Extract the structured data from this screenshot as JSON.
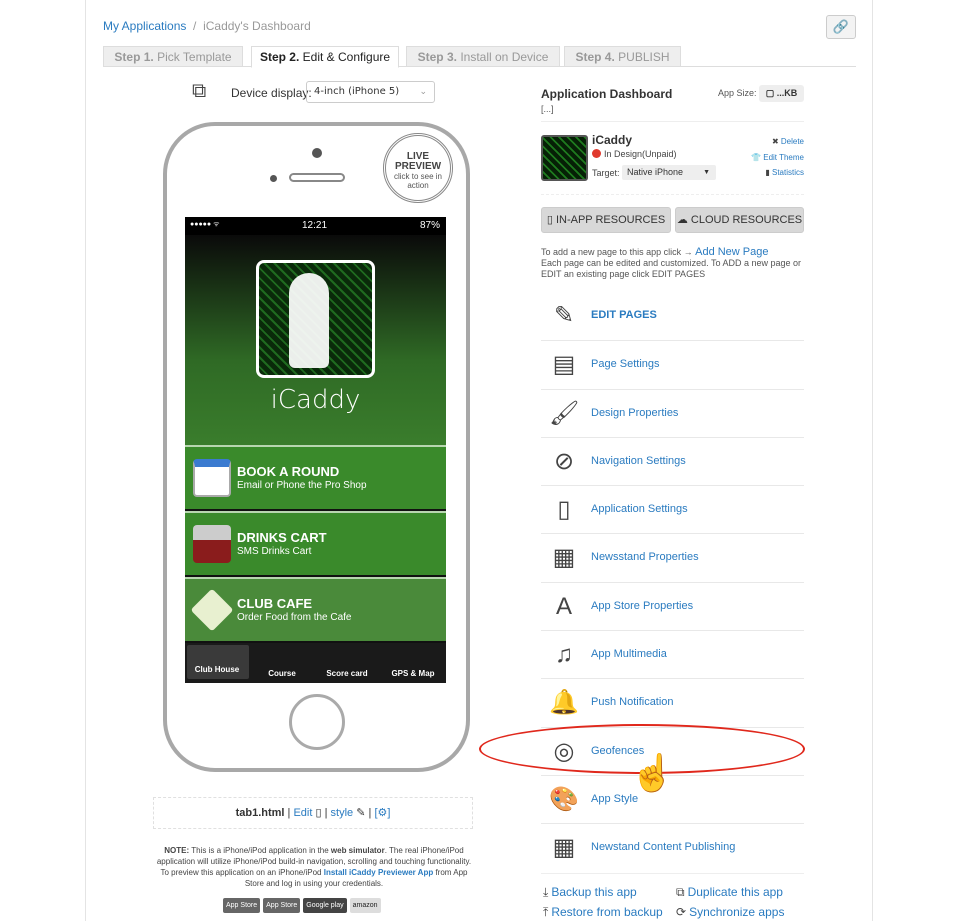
{
  "breadcrumb": {
    "home": "My Applications",
    "sep": "/",
    "current": "iCaddy's Dashboard"
  },
  "link_icon": "link-icon",
  "steps": [
    {
      "num": "Step 1.",
      "label": "Pick Template"
    },
    {
      "num": "Step 2.",
      "label": "Edit & Configure"
    },
    {
      "num": "Step 3.",
      "label": "Install on Device"
    },
    {
      "num": "Step 4.",
      "label": "PUBLISH"
    }
  ],
  "device": {
    "label": "Device display:",
    "value": "4-inch (iPhone 5)"
  },
  "phone": {
    "live_title": "LIVE PREVIEW",
    "live_sub": "click to see in action",
    "status_signal": "●●●●● ᯤ",
    "time": "12:21",
    "battery": "87%",
    "app_title": "iCaddy",
    "rows": [
      {
        "title": "BOOK A ROUND",
        "sub": "Email or Phone the Pro Shop",
        "icon": "calendar-icon"
      },
      {
        "title": "DRINKS CART",
        "sub": "SMS Drinks Cart",
        "icon": "golf-cart-icon"
      },
      {
        "title": "CLUB CAFE",
        "sub": "Order Food from the Cafe",
        "icon": "cutlery-icon"
      }
    ],
    "tabs": [
      "Club House",
      "Course",
      "Score card",
      "GPS & Map"
    ]
  },
  "filebar": {
    "file": "tab1.html",
    "edit": "Edit",
    "style": "style",
    "sep": "|",
    "settings": "[⚙]"
  },
  "note": {
    "lead": "NOTE:",
    "t1": " This is a iPhone/iPod application in the ",
    "b1": "web simulator",
    "t2": ". The real iPhone/iPod application will utilize iPhone/iPod build-in navigation, scrolling and touching functionality. To preview this application on an iPhone/iPod ",
    "link": "Install iCaddy Previewer App",
    "t3": " from App Store and log in using your credentials."
  },
  "stores": [
    "App Store",
    "App Store",
    "Google play",
    "amazon"
  ],
  "dashboard": {
    "title": "Application Dashboard",
    "dots": "[...]",
    "size_label": "App Size:",
    "size_value": "...KB",
    "app_name": "iCaddy",
    "status": "In Design(Unpaid)",
    "status_color": "#e03a2e",
    "target_label": "Target:",
    "target_value": "Native iPhone",
    "delete": "Delete",
    "edit_theme": "Edit Theme",
    "statistics": "Statistics",
    "inapp": "IN-APP RESOURCES",
    "cloud": "CLOUD RESOURCES",
    "help1": "To add a new page to this app click →",
    "help_link": "Add New Page",
    "help2": "Each page can be edited and customized. To ADD a new page or EDIT an existing page click EDIT PAGES"
  },
  "menu": [
    {
      "label": "EDIT PAGES",
      "icon": "pencil-icon",
      "glyph": "✎"
    },
    {
      "label": "Page Settings",
      "icon": "page-settings-icon",
      "glyph": "▤"
    },
    {
      "label": "Design Properties",
      "icon": "brush-css-icon",
      "glyph": "🖌"
    },
    {
      "label": "Navigation Settings",
      "icon": "compass-icon",
      "glyph": "⊘"
    },
    {
      "label": "Application Settings",
      "icon": "phone-settings-icon",
      "glyph": "▯"
    },
    {
      "label": "Newsstand Properties",
      "icon": "newsstand-icon",
      "glyph": "▦"
    },
    {
      "label": "App Store Properties",
      "icon": "app-store-icon",
      "glyph": "A"
    },
    {
      "label": "App Multimedia",
      "icon": "multimedia-icon",
      "glyph": "♫"
    },
    {
      "label": "Push Notification",
      "icon": "bell-icon",
      "glyph": "🔔"
    },
    {
      "label": "Geofences",
      "icon": "geofence-icon",
      "glyph": "◎"
    },
    {
      "label": "App Style",
      "icon": "palette-icon",
      "glyph": "🎨"
    },
    {
      "label": "Newstand Content Publishing",
      "icon": "grid-icon",
      "glyph": "▦"
    }
  ],
  "actions": {
    "backup": "Backup this app",
    "restore": "Restore from backup",
    "duplicate": "Duplicate this app",
    "sync": "Synchronize apps"
  },
  "annotation_color": "#e0281c"
}
